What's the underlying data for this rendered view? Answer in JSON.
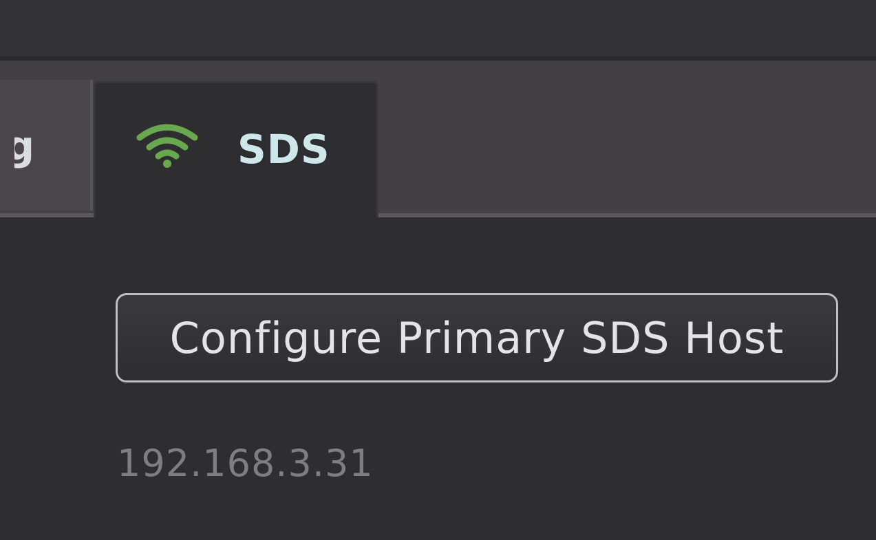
{
  "tabs": {
    "previous": {
      "label": "ng"
    },
    "active": {
      "label": "SDS",
      "icon": "wifi-signal-icon",
      "icon_color": "#6aa84f"
    }
  },
  "sds": {
    "configure_button_label": "Configure Primary SDS Host",
    "primary_host_ip": "192.168.3.31"
  }
}
